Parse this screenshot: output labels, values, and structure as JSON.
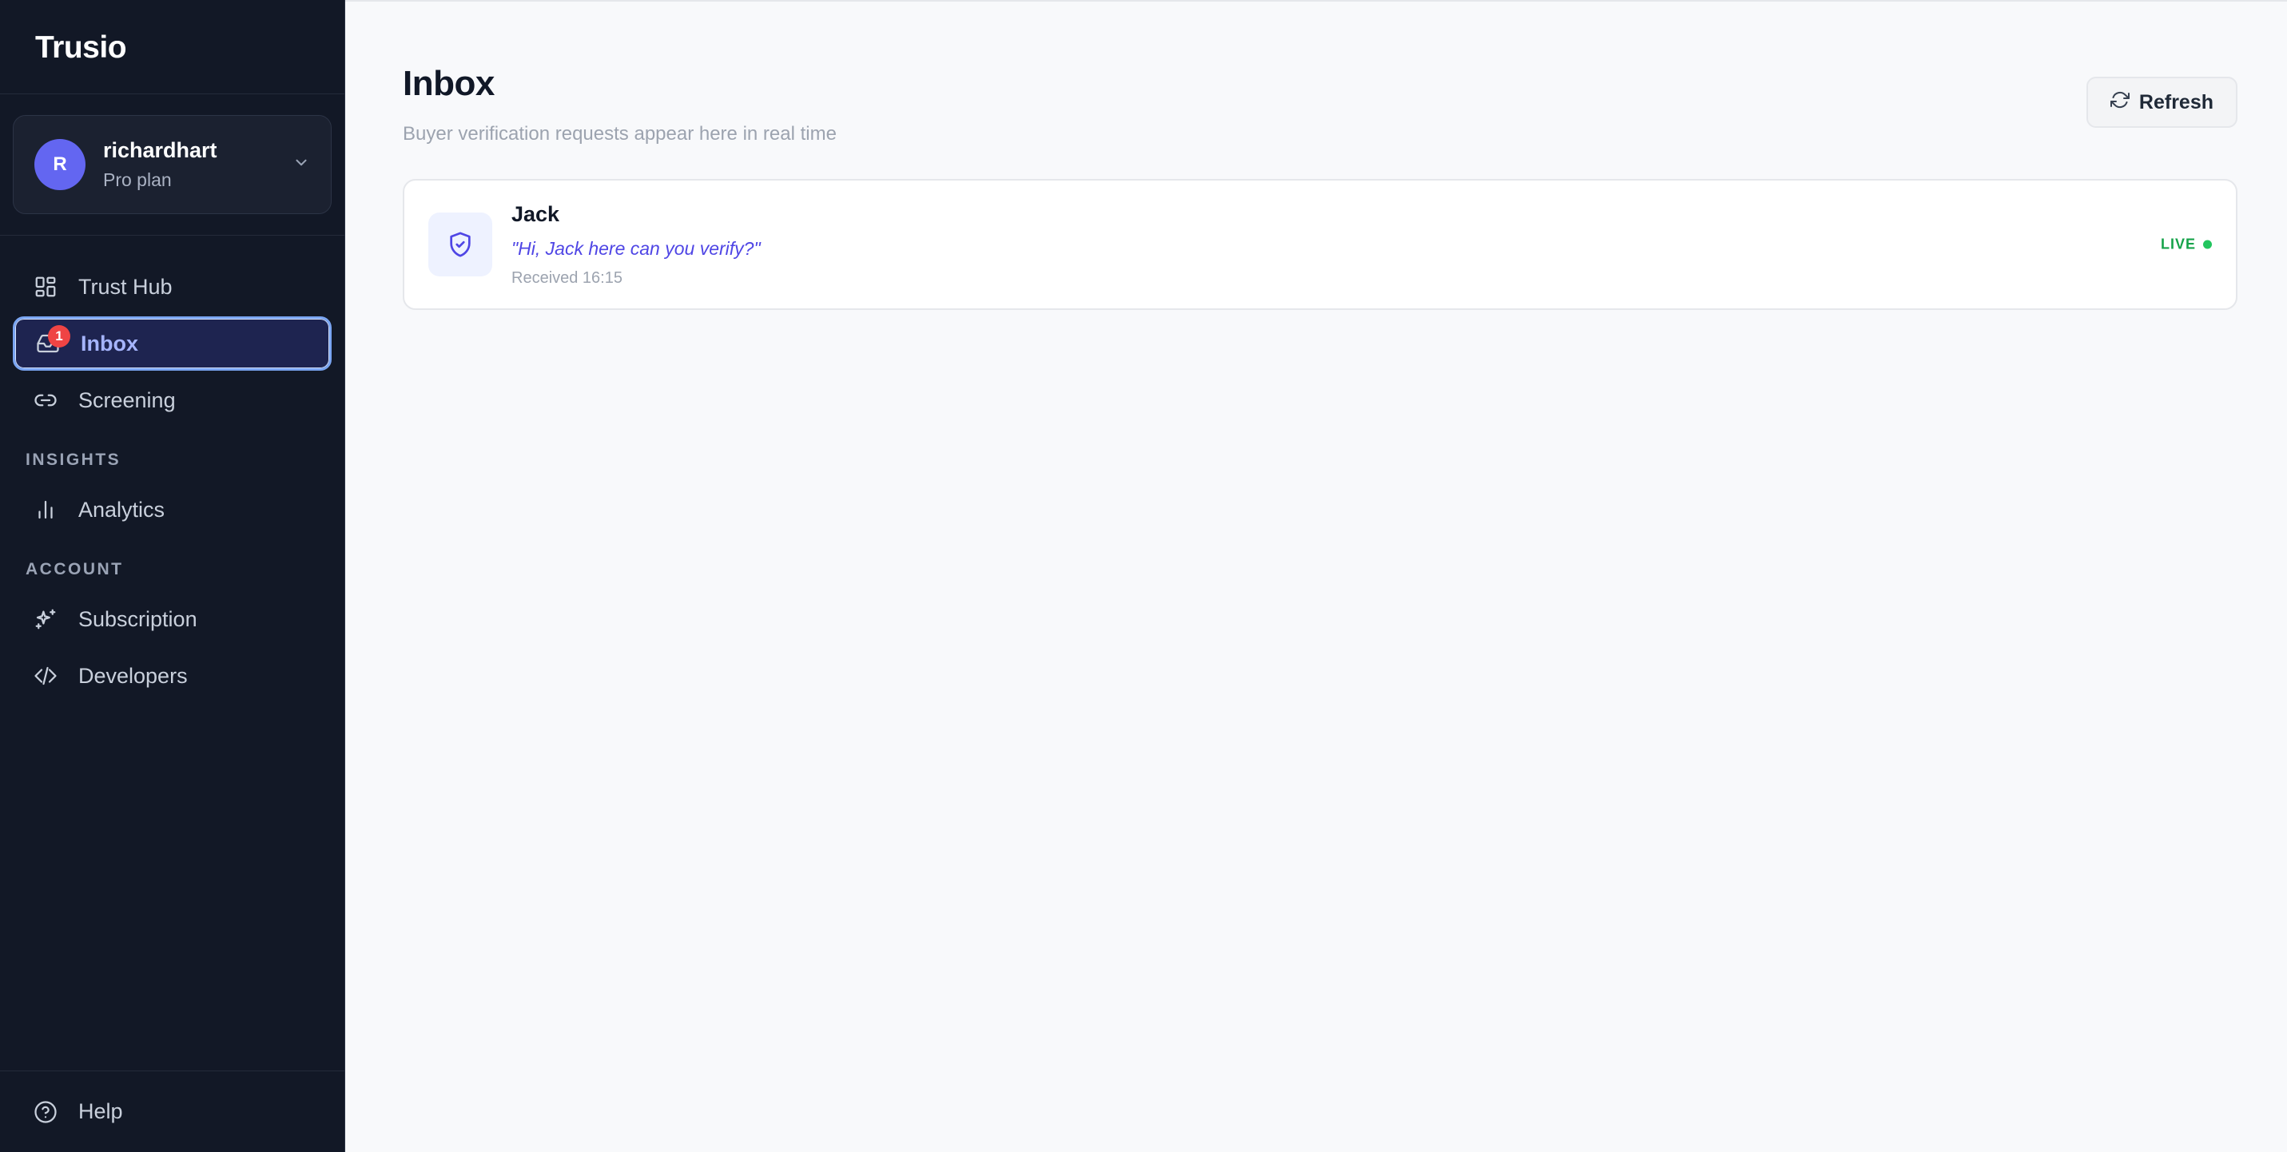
{
  "app": {
    "brand": "Trusio"
  },
  "account": {
    "initial": "R",
    "username": "richardhart",
    "plan": "Pro plan"
  },
  "nav": {
    "primary": [
      {
        "label": "Trust Hub",
        "icon": "grid-icon"
      },
      {
        "label": "Inbox",
        "icon": "inbox-icon",
        "badge": "1",
        "active": true
      },
      {
        "label": "Screening",
        "icon": "link-icon"
      }
    ],
    "sections": [
      {
        "title": "INSIGHTS",
        "items": [
          {
            "label": "Analytics",
            "icon": "bar-chart-icon"
          }
        ]
      },
      {
        "title": "ACCOUNT",
        "items": [
          {
            "label": "Subscription",
            "icon": "sparkles-icon"
          },
          {
            "label": "Developers",
            "icon": "code-icon"
          }
        ]
      }
    ],
    "footer": {
      "label": "Help",
      "icon": "help-circle-icon"
    }
  },
  "page": {
    "title": "Inbox",
    "subtitle": "Buyer verification requests appear here in real time",
    "refresh_label": "Refresh"
  },
  "requests": [
    {
      "name": "Jack",
      "message": "\"Hi, Jack here can you verify?\"",
      "received": "Received 16:15",
      "status": "LIVE",
      "icon": "shield-check-icon"
    }
  ],
  "colors": {
    "sidebar_bg": "#121826",
    "accent": "#6366f1",
    "active_border": "#7aa5f2",
    "badge": "#ef4444",
    "live": "#16a34a"
  }
}
